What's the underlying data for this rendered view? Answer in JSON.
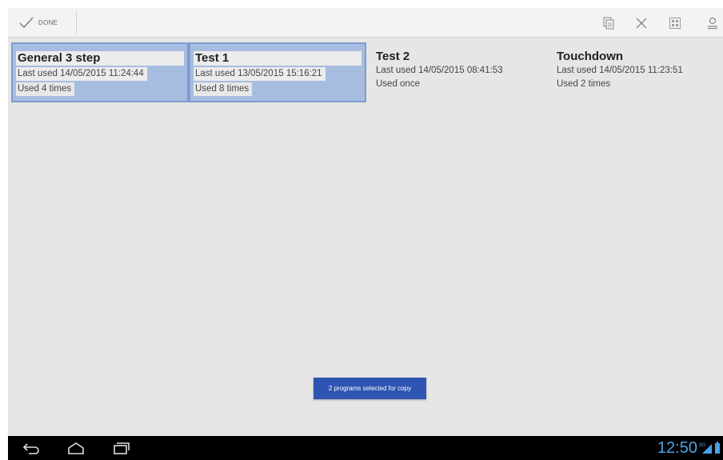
{
  "action_bar": {
    "done_label": "DONE",
    "icons": [
      "checkmark-icon",
      "copy-icon",
      "close-icon",
      "grid-select-icon",
      "user-icon"
    ]
  },
  "programs": [
    {
      "name": "General 3 step",
      "last_used": "Last used 14/05/2015 11:24:44",
      "usage": "Used 4 times",
      "selected": true
    },
    {
      "name": "Test 1",
      "last_used": "Last used 13/05/2015 15:16:21",
      "usage": "Used 8 times",
      "selected": true
    },
    {
      "name": "Test 2",
      "last_used": "Last used 14/05/2015 08:41:53",
      "usage": "Used once",
      "selected": false
    },
    {
      "name": "Touchdown",
      "last_used": "Last used 14/05/2015 11:23:51",
      "usage": "Used 2 times",
      "selected": false
    }
  ],
  "toast": "2 programs selected for copy",
  "status_bar": {
    "clock": "12:50",
    "network": "3G",
    "accent_color": "#4aa3e6"
  },
  "colors": {
    "selection_fill": "#a7bde0",
    "selection_border": "#7d9bd0",
    "toast_bg": "#2f55b2"
  }
}
